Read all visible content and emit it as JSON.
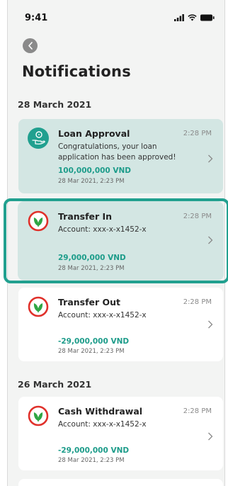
{
  "status_bar": {
    "time": "9:41"
  },
  "header": {
    "title": "Notifications"
  },
  "sections": [
    {
      "date": "28 March 2021"
    },
    {
      "date": "26 March 2021"
    }
  ],
  "notifications": [
    {
      "title": "Loan Approval",
      "time": "2:28 PM",
      "line1": "Congratulations, your loan",
      "line2": "application has been approved!",
      "amount": "100,000,000 VND",
      "datetime": "28 Mar 2021, 2:23 PM",
      "icon": "loan-hand-icon",
      "unread": true
    },
    {
      "title": "Transfer In",
      "time": "2:28 PM",
      "line1": "Account: xxx-x-x1452-x",
      "amount": "29,000,000 VND",
      "datetime": "28 Mar 2021, 2:23 PM",
      "icon": "bank-logo-icon",
      "unread": true
    },
    {
      "title": "Transfer Out",
      "time": "2:28 PM",
      "line1": "Account: xxx-x-x1452-x",
      "amount": "-29,000,000 VND",
      "datetime": "28 Mar 2021, 2:23 PM",
      "icon": "bank-logo-icon",
      "unread": false
    },
    {
      "title": "Cash Withdrawal",
      "time": "2:28 PM",
      "line1": "Account: xxx-x-x1452-x",
      "amount": "-29,000,000 VND",
      "datetime": "28 Mar 2021, 2:23 PM",
      "icon": "bank-logo-icon",
      "unread": false
    }
  ],
  "colors": {
    "accent": "#21a08f",
    "amount": "#1d9c8a",
    "unread_bg": "#d3e6e3",
    "logo_red": "#e0312b",
    "logo_green": "#2fa644"
  }
}
